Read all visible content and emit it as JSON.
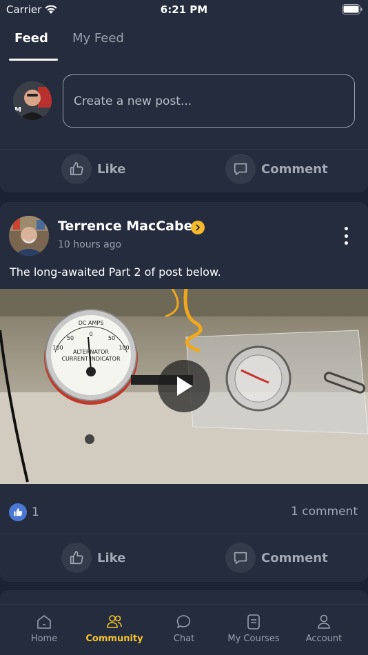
{
  "status_bar": {
    "carrier": "Carrier",
    "time": "6:21 PM"
  },
  "tabs": [
    {
      "label": "Feed",
      "active": true
    },
    {
      "label": "My Feed",
      "active": false
    }
  ],
  "composer": {
    "placeholder": "Create a new post..."
  },
  "actions": {
    "like_label": "Like",
    "comment_label": "Comment"
  },
  "post": {
    "author": "Terrence MacCabe",
    "time": "10 hours ago",
    "text": "The long-awaited Part 2 of post below.",
    "media": {
      "meter_label_top": "DC AMPS",
      "meter_label_mid": "ALTERNATOR",
      "meter_label_bottom": "CURRENT INDICATOR",
      "meter_scale": [
        "100",
        "50",
        "0",
        "50",
        "100"
      ]
    },
    "like_count": "1",
    "comment_count": "1 comment"
  },
  "nav": [
    {
      "label": "Home",
      "icon": "home-icon",
      "active": false
    },
    {
      "label": "Community",
      "icon": "community-icon",
      "active": true
    },
    {
      "label": "Chat",
      "icon": "chat-icon",
      "active": false
    },
    {
      "label": "My Courses",
      "icon": "courses-icon",
      "active": false
    },
    {
      "label": "Account",
      "icon": "account-icon",
      "active": false
    }
  ],
  "colors": {
    "background": "#1b2233",
    "card": "#242c3d",
    "accent": "#f5c42e",
    "like_blue": "#4a78d4"
  }
}
